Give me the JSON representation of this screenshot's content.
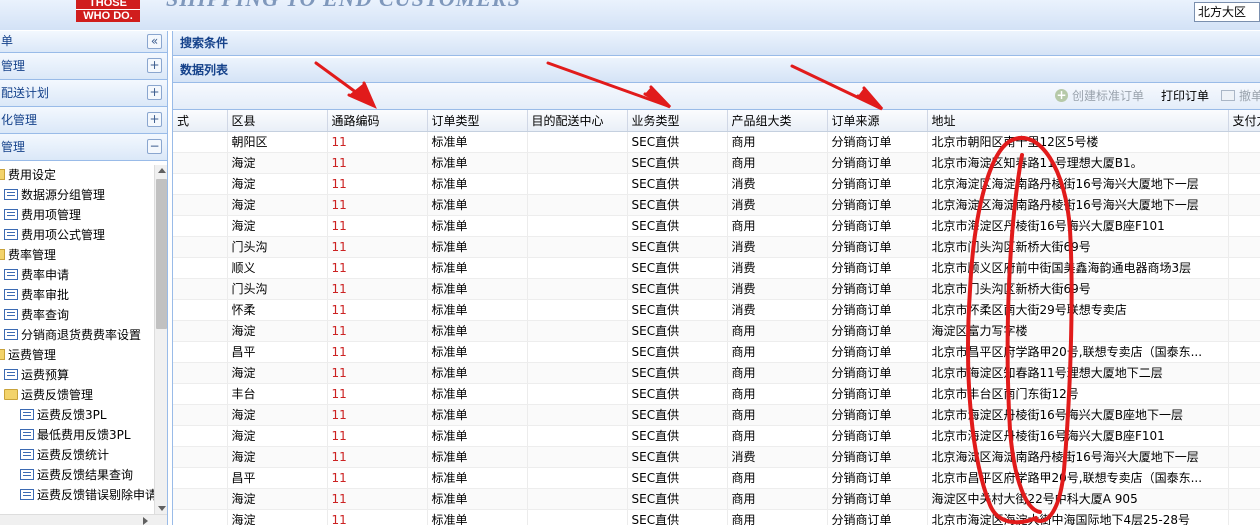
{
  "header": {
    "logo_line1": "THOSE",
    "logo_line2": "WHO DO.",
    "slogan": "SHIPPING TO END CUSTOMERS",
    "region_selected": "北方大区"
  },
  "sidebar": {
    "top_label": "单",
    "sections": [
      {
        "label": "管理"
      },
      {
        "label": "配送计划"
      },
      {
        "label": "化管理"
      },
      {
        "label": "管理"
      }
    ],
    "tree": [
      {
        "label": "费用设定",
        "icon": "folder-half",
        "indent": 0
      },
      {
        "label": "数据源分组管理",
        "icon": "doc",
        "indent": 1
      },
      {
        "label": "费用项管理",
        "icon": "doc",
        "indent": 1
      },
      {
        "label": "费用项公式管理",
        "icon": "doc",
        "indent": 1
      },
      {
        "label": "费率管理",
        "icon": "folder-half",
        "indent": 0
      },
      {
        "label": "费率申请",
        "icon": "doc",
        "indent": 1
      },
      {
        "label": "费率审批",
        "icon": "doc",
        "indent": 1
      },
      {
        "label": "费率查询",
        "icon": "doc",
        "indent": 1
      },
      {
        "label": "分销商退货费费率设置",
        "icon": "doc",
        "indent": 1
      },
      {
        "label": "运费管理",
        "icon": "folder-half",
        "indent": 0
      },
      {
        "label": "运费预算",
        "icon": "doc",
        "indent": 1
      },
      {
        "label": "运费反馈管理",
        "icon": "folder",
        "indent": 1
      },
      {
        "label": "运费反馈3PL",
        "icon": "doc",
        "indent": 2
      },
      {
        "label": "最低费用反馈3PL",
        "icon": "doc",
        "indent": 2
      },
      {
        "label": "运费反馈统计",
        "icon": "doc",
        "indent": 2
      },
      {
        "label": "运费反馈结果查询",
        "icon": "doc",
        "indent": 2
      },
      {
        "label": "运费反馈错误剔除申请",
        "icon": "doc",
        "indent": 2
      }
    ]
  },
  "main": {
    "search_panel_title": "搜索条件",
    "list_panel_title": "数据列表",
    "toolbar": {
      "create_label": "创建标准订单",
      "print_label": "打印订单",
      "withdraw_label": "撤单"
    },
    "columns": [
      "式",
      "区县",
      "通路编码",
      "订单类型",
      "目的配送中心",
      "业务类型",
      "产品组大类",
      "订单来源",
      "地址",
      "支付方"
    ],
    "rows": [
      [
        "",
        "朝阳区",
        "11",
        "标准单",
        "",
        "SEC直供",
        "商用",
        "分销商订单",
        "北京市朝阳区南十里12区5号楼",
        ""
      ],
      [
        "",
        "海淀",
        "11",
        "标准单",
        "",
        "SEC直供",
        "商用",
        "分销商订单",
        "北京市海淀区知春路11号理想大厦B1。",
        ""
      ],
      [
        "",
        "海淀",
        "11",
        "标准单",
        "",
        "SEC直供",
        "消费",
        "分销商订单",
        "北京海淀区海淀南路丹棱街16号海兴大厦地下一层",
        ""
      ],
      [
        "",
        "海淀",
        "11",
        "标准单",
        "",
        "SEC直供",
        "消费",
        "分销商订单",
        "北京海淀区海淀南路丹棱街16号海兴大厦地下一层",
        ""
      ],
      [
        "",
        "海淀",
        "11",
        "标准单",
        "",
        "SEC直供",
        "商用",
        "分销商订单",
        "北京市海淀区丹棱街16号海兴大厦B座F101",
        ""
      ],
      [
        "",
        "门头沟",
        "11",
        "标准单",
        "",
        "SEC直供",
        "消费",
        "分销商订单",
        "北京市门头沟区新桥大街69号",
        ""
      ],
      [
        "",
        "顺义",
        "11",
        "标准单",
        "",
        "SEC直供",
        "消费",
        "分销商订单",
        "北京市顺义区府前中街国美鑫海韵通电器商场3层",
        ""
      ],
      [
        "",
        "门头沟",
        "11",
        "标准单",
        "",
        "SEC直供",
        "消费",
        "分销商订单",
        "北京市门头沟区新桥大街69号",
        ""
      ],
      [
        "",
        "怀柔",
        "11",
        "标准单",
        "",
        "SEC直供",
        "消费",
        "分销商订单",
        "北京市怀柔区南大街29号联想专卖店",
        ""
      ],
      [
        "",
        "海淀",
        "11",
        "标准单",
        "",
        "SEC直供",
        "商用",
        "分销商订单",
        "海淀区富力写字楼",
        ""
      ],
      [
        "",
        "昌平",
        "11",
        "标准单",
        "",
        "SEC直供",
        "商用",
        "分销商订单",
        "北京市昌平区府学路甲20号,联想专卖店（国泰东...",
        ""
      ],
      [
        "",
        "海淀",
        "11",
        "标准单",
        "",
        "SEC直供",
        "商用",
        "分销商订单",
        "北京市海淀区知春路11号理想大厦地下二层",
        ""
      ],
      [
        "",
        "丰台",
        "11",
        "标准单",
        "",
        "SEC直供",
        "商用",
        "分销商订单",
        "北京市丰台区南门东街12号",
        ""
      ],
      [
        "",
        "海淀",
        "11",
        "标准单",
        "",
        "SEC直供",
        "商用",
        "分销商订单",
        "北京市海淀区丹棱街16号海兴大厦B座地下一层",
        ""
      ],
      [
        "",
        "海淀",
        "11",
        "标准单",
        "",
        "SEC直供",
        "商用",
        "分销商订单",
        "北京市海淀区丹棱街16号海兴大厦B座F101",
        ""
      ],
      [
        "",
        "海淀",
        "11",
        "标准单",
        "",
        "SEC直供",
        "消费",
        "分销商订单",
        "北京海淀区海淀南路丹棱街16号海兴大厦地下一层",
        ""
      ],
      [
        "",
        "昌平",
        "11",
        "标准单",
        "",
        "SEC直供",
        "商用",
        "分销商订单",
        "北京市昌平区府学路甲20号,联想专卖店（国泰东...",
        ""
      ],
      [
        "",
        "海淀",
        "11",
        "标准单",
        "",
        "SEC直供",
        "商用",
        "分销商订单",
        "海淀区中关村大街22号中科大厦A 905",
        ""
      ],
      [
        "",
        "海淀",
        "11",
        "标准单",
        "",
        "SEC直供",
        "商用",
        "分销商订单",
        "北京市海淀区海淀大街中海国际地下4层25-28号",
        ""
      ]
    ]
  },
  "colors": {
    "panel_title": "#15428b",
    "border": "#99bbe8",
    "code_text": "#cc2222",
    "annotation": "#e11b1b"
  }
}
